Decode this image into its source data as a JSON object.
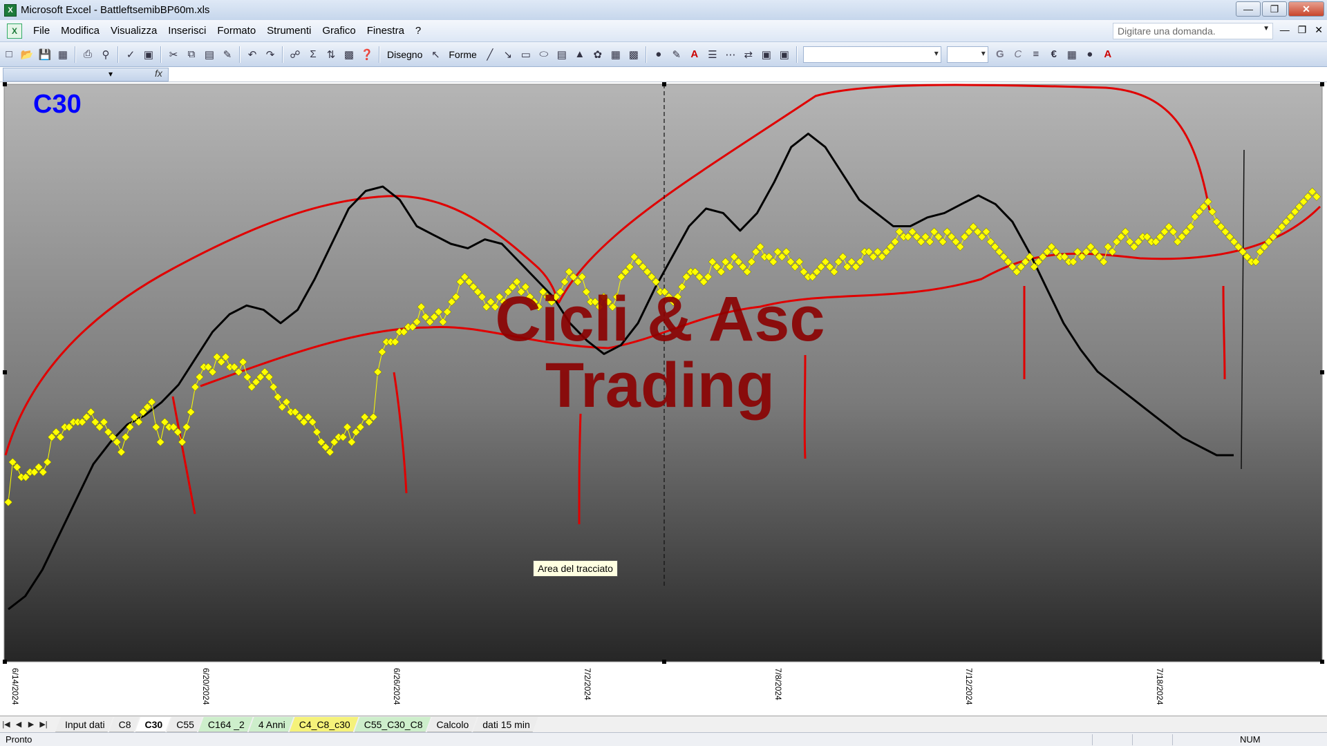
{
  "window": {
    "title": "Microsoft Excel - BattleftsemibBP60m.xls",
    "controls": [
      "minimize",
      "restore",
      "close"
    ]
  },
  "menubar": {
    "items": [
      "File",
      "Modifica",
      "Visualizza",
      "Inserisci",
      "Formato",
      "Strumenti",
      "Grafico",
      "Finestra",
      "?"
    ],
    "ask_placeholder": "Digitare una domanda."
  },
  "toolbar": {
    "draw_label": "Disegno",
    "shapes_label": "Forme",
    "bold_label": "G",
    "italic_label": "C",
    "currency_label": "€"
  },
  "chart": {
    "title": "C30",
    "watermark_line1": "Cicli & Asc",
    "watermark_line2": "Trading",
    "tooltip": "Area del tracciato",
    "colors": {
      "bg_top": "#b3b3b3",
      "bg_bottom": "#2a2a2a",
      "price": "#ffff00",
      "cycle": "#000000",
      "drawing": "#e00000",
      "title": "#0000ff",
      "watermark": "#8b0000"
    }
  },
  "chart_data": {
    "type": "line",
    "title": "C30",
    "xlabel": "",
    "ylabel": "",
    "x_ticks": [
      "6/14/2024",
      "6/20/2024",
      "6/26/2024",
      "7/2/2024",
      "7/8/2024",
      "7/12/2024",
      "7/18/2024"
    ],
    "x_range": [
      0,
      310
    ],
    "y_range": [
      0,
      100
    ],
    "grid": false,
    "legend": "none",
    "series": [
      {
        "style": "markers",
        "color": "#ffff00",
        "values": [
          32,
          40,
          39,
          37,
          37,
          38,
          38,
          39,
          38,
          40,
          45,
          46,
          45,
          47,
          47,
          48,
          48,
          48,
          49,
          50,
          48,
          47,
          48,
          46,
          45,
          44,
          42,
          45,
          47,
          49,
          48,
          50,
          51,
          52,
          47,
          44,
          48,
          47,
          47,
          46,
          44,
          47,
          50,
          55,
          57,
          59,
          59,
          58,
          61,
          60,
          61,
          59,
          59,
          58,
          60,
          57,
          55,
          56,
          57,
          58,
          57,
          55,
          53,
          51,
          52,
          50,
          50,
          49,
          48,
          49,
          48,
          46,
          44,
          43,
          42,
          44,
          45,
          45,
          47,
          44,
          46,
          47,
          49,
          48,
          49,
          58,
          62,
          64,
          64,
          64,
          66,
          66,
          67,
          67,
          68,
          71,
          69,
          68,
          69,
          70,
          68,
          70,
          72,
          73,
          76,
          77,
          76,
          75,
          74,
          73,
          71,
          72,
          71,
          73,
          72,
          74,
          75,
          76,
          74,
          75,
          73,
          72,
          71,
          74,
          73,
          72,
          73,
          74,
          76,
          78,
          77,
          76,
          77,
          74,
          72,
          72,
          71,
          73,
          72,
          71,
          73,
          77,
          78,
          79,
          81,
          80,
          79,
          78,
          77,
          76,
          74,
          74,
          73,
          72,
          73,
          75,
          77,
          78,
          78,
          77,
          76,
          77,
          80,
          79,
          78,
          80,
          79,
          81,
          80,
          79,
          78,
          80,
          82,
          83,
          81,
          81,
          80,
          82,
          81,
          82,
          80,
          79,
          80,
          78,
          77,
          77,
          78,
          79,
          80,
          79,
          78,
          80,
          81,
          79,
          80,
          79,
          80,
          82,
          82,
          81,
          82,
          81,
          82,
          83,
          84,
          86,
          85,
          85,
          86,
          85,
          84,
          85,
          84,
          86,
          85,
          84,
          86,
          85,
          84,
          83,
          85,
          86,
          87,
          86,
          85,
          86,
          84,
          83,
          82,
          81,
          80,
          79,
          78,
          79,
          80,
          81,
          79,
          80,
          81,
          82,
          83,
          82,
          81,
          81,
          80,
          80,
          82,
          81,
          82,
          83,
          82,
          81,
          80,
          83,
          82,
          84,
          85,
          86,
          84,
          83,
          84,
          85,
          85,
          84,
          84,
          85,
          86,
          87,
          86,
          84,
          85,
          86,
          87,
          89,
          90,
          91,
          92,
          90,
          88,
          87,
          86,
          85,
          84,
          83,
          82,
          81,
          80,
          80,
          82,
          83,
          84,
          85,
          86,
          87,
          88,
          89,
          90,
          91,
          92,
          93,
          94,
          93
        ],
        "note_values_scaled": true
      },
      {
        "style": "line",
        "color": "#000000",
        "values": [
          5,
          8,
          14,
          22,
          30,
          38,
          43,
          47,
          49,
          52,
          56,
          62,
          68,
          72,
          74,
          73,
          70,
          73,
          80,
          88,
          96,
          100,
          101,
          98,
          92,
          90,
          88,
          87,
          89,
          88,
          84,
          80,
          76,
          70,
          66,
          63,
          65,
          70,
          78,
          85,
          92,
          96,
          95,
          91,
          95,
          102,
          110,
          113,
          110,
          104,
          98,
          95,
          92,
          92,
          94,
          95,
          97,
          99,
          97,
          93,
          86,
          78,
          70,
          64,
          59,
          56,
          53,
          50,
          47,
          44,
          42,
          40,
          40
        ],
        "note_values_scaled": true
      }
    ]
  },
  "sheets": {
    "tabs": [
      {
        "label": "Input dati",
        "kind": "gray"
      },
      {
        "label": "C8",
        "kind": "gray"
      },
      {
        "label": "C30",
        "kind": "active"
      },
      {
        "label": "C55",
        "kind": "gray"
      },
      {
        "label": "C164 _2",
        "kind": "green"
      },
      {
        "label": "4 Anni",
        "kind": "green"
      },
      {
        "label": "C4_C8_c30",
        "kind": "yellow"
      },
      {
        "label": "C55_C30_C8",
        "kind": "green"
      },
      {
        "label": "Calcolo",
        "kind": "gray"
      },
      {
        "label": "dati 15 min",
        "kind": "gray"
      }
    ]
  },
  "statusbar": {
    "status": "Pronto",
    "num": "NUM"
  }
}
